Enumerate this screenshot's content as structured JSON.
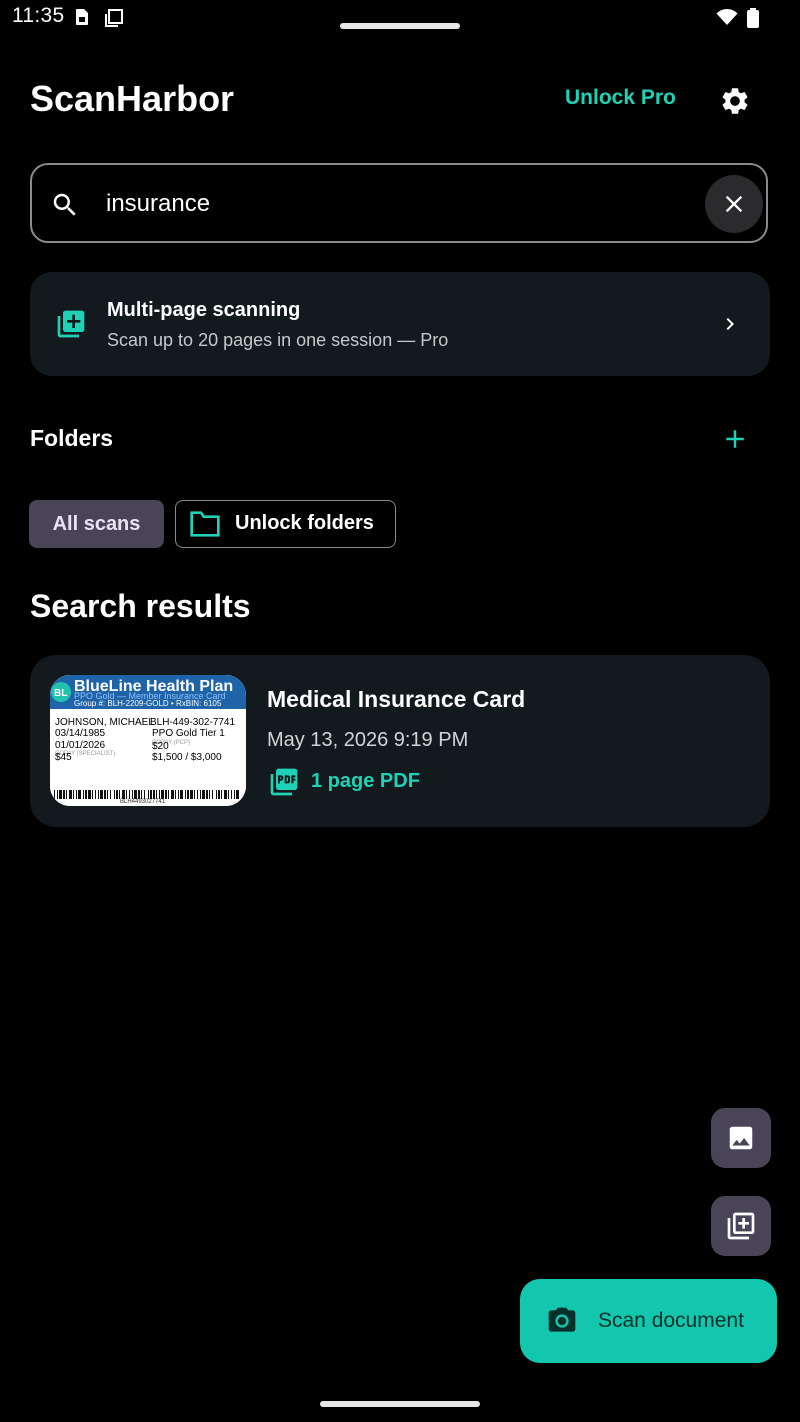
{
  "status_bar": {
    "time": "11:35"
  },
  "header": {
    "app_title": "ScanHarbor",
    "unlock_pro": "Unlock Pro"
  },
  "search": {
    "value": "insurance",
    "placeholder": ""
  },
  "promo": {
    "title": "Multi-page scanning",
    "subtitle": "Scan up to 20 pages in one session — Pro"
  },
  "folders": {
    "label": "Folders",
    "chips": [
      {
        "label": "All scans",
        "selected": true
      },
      {
        "label": "Unlock folders",
        "selected": false
      }
    ]
  },
  "results": {
    "heading": "Search results",
    "items": [
      {
        "title": "Medical Insurance Card",
        "date": "May 13, 2026 9:19 PM",
        "pages": "1 page PDF",
        "thumbnail": {
          "logo": "BL",
          "plan_name": "BlueLine Health Plan",
          "subtitle": "PPO Gold — Member Insurance Card",
          "group_line": "Group #: BLH-2209-GOLD  •  RxBIN: 6105",
          "name": "JOHNSON, MICHAEL",
          "member_id": "BLH-449-302-7741",
          "dob": "03/14/1985",
          "plan_tier": "PPO Gold Tier 1",
          "effective": "01/01/2026",
          "copay_pcp": "$20",
          "copay_specialist": "$45",
          "deductible": "$1,500 / $3,000",
          "label_pcp": "COPAY (PCP)",
          "label_specialist": "COPAY (SPECIALIST)",
          "barcode_text": "BLH4493027741"
        }
      }
    ]
  },
  "fab": {
    "scan_label": "Scan document"
  },
  "icons": {
    "search": "search-icon",
    "clear": "close-icon",
    "settings": "gear-icon",
    "promo": "add-pages-icon",
    "chevron": "chevron-right-icon",
    "add_folder": "plus-icon",
    "folder": "folder-icon",
    "pdf": "pdf-icon",
    "gallery": "image-icon",
    "multipage": "add-pages-icon",
    "camera": "camera-icon"
  },
  "colors": {
    "accent": "#1fd1b5",
    "fab": "#12c7ad",
    "chip_selected": "#4a4458",
    "card": "#121a1d",
    "background": "#000000"
  }
}
